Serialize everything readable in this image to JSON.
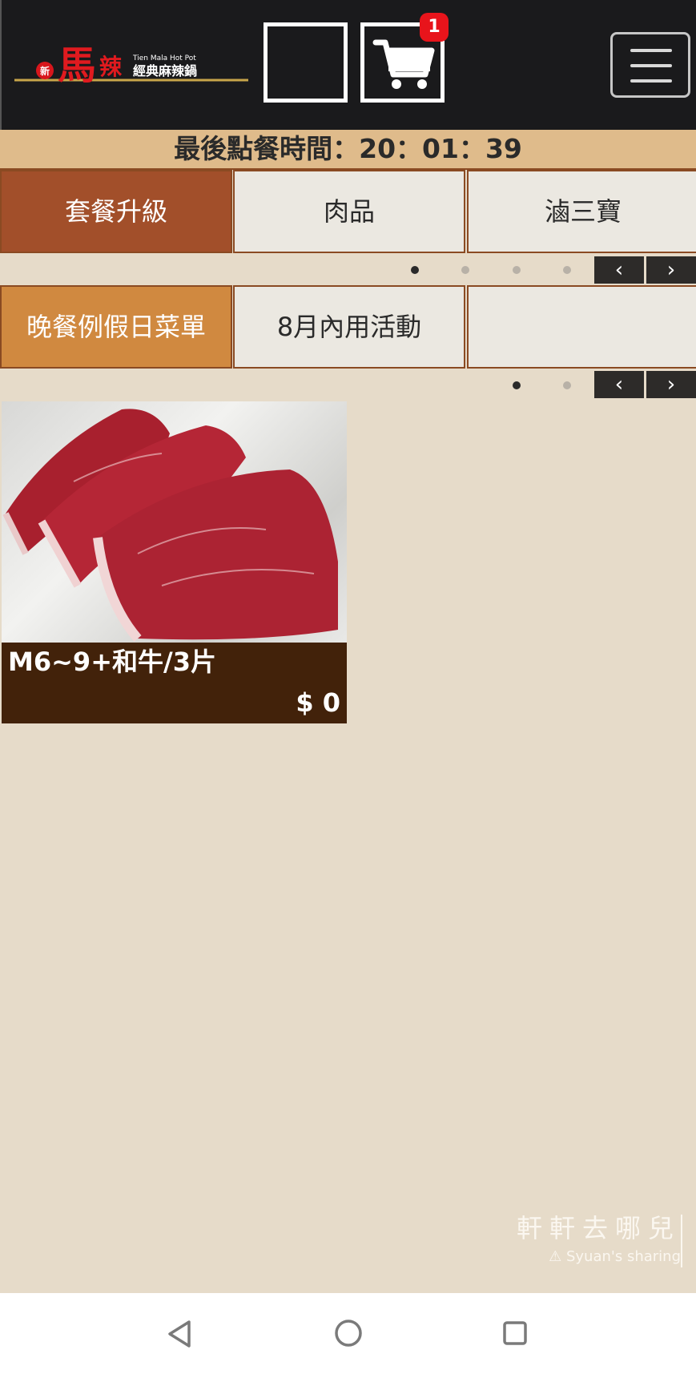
{
  "header": {
    "logo_alt": "馬辣 經典麻辣鍋",
    "cart_count": "1",
    "icons": {
      "cart": "cart-icon",
      "menu": "hamburger-menu-icon",
      "logo": "restaurant-logo"
    }
  },
  "timer": {
    "label": "最後點餐時間：",
    "time": "20：01：39"
  },
  "category_rows": [
    {
      "tabs": [
        "套餐升級",
        "肉品",
        "滷三寶"
      ],
      "active_index": 0
    },
    {
      "tabs": [
        "晚餐例假日菜單",
        "8月內用活動",
        ""
      ],
      "active_index": 0
    }
  ],
  "pager": {
    "prev_label": "‹",
    "next_label": "›"
  },
  "products": [
    {
      "name": "M6~9+和牛/3片",
      "price": "$ 0"
    }
  ],
  "watermark": {
    "title": "軒軒去哪兒",
    "subtitle": "Syuan's sharing"
  },
  "colors": {
    "header_bg": "#1a1a1c",
    "timer_bg": "#dfbb8b",
    "active_tab_1": "#a24f2a",
    "active_tab_2": "#d08940",
    "page_bg": "#e6dbc9",
    "product_footer": "#42220a",
    "badge": "#e8141b"
  }
}
